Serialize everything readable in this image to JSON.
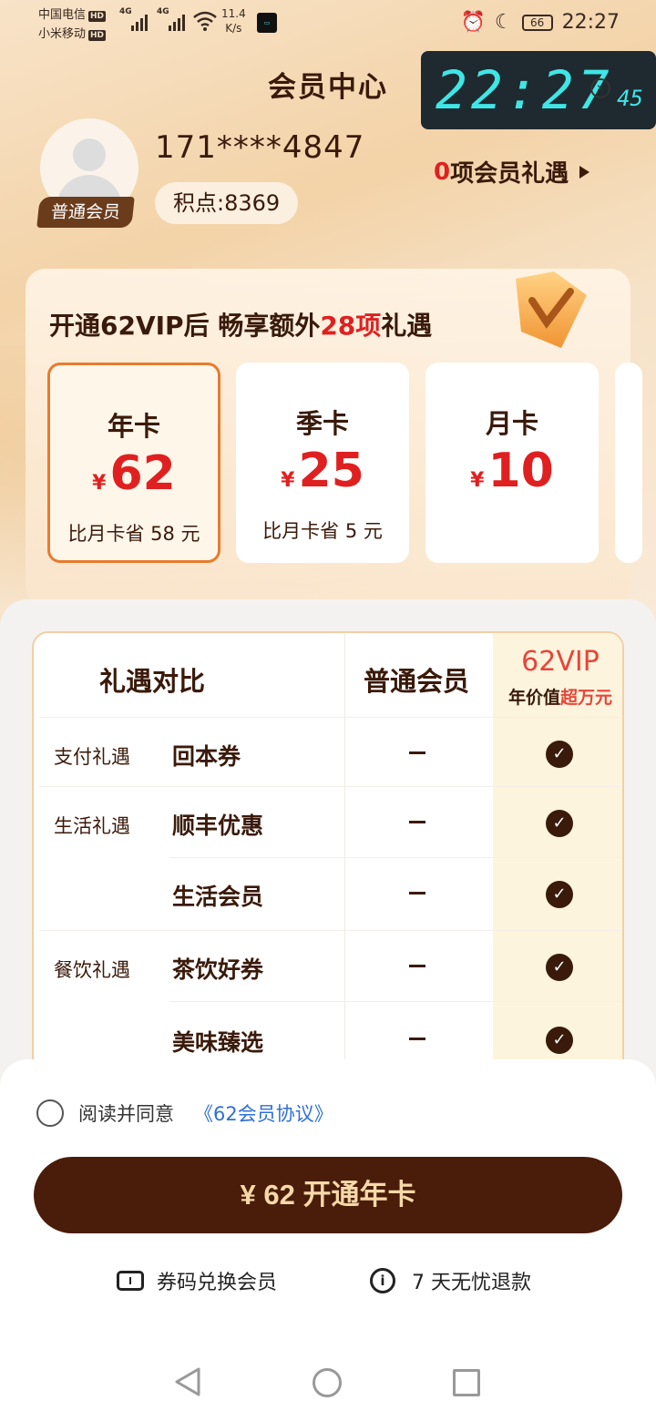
{
  "status": {
    "carrier1": "中国电信",
    "carrier2": "小米移动",
    "hd": "HD",
    "net": "4G",
    "speed_value": "11.4",
    "speed_unit": "K/s",
    "battery": "66",
    "time": "22:27"
  },
  "clock_widget": {
    "hm": "22:27",
    "sec": "45"
  },
  "header": {
    "title": "会员中心"
  },
  "user": {
    "phone": "171****4847",
    "level_badge": "普通会员",
    "points_label": "积点:8369",
    "benefit_count": "0",
    "benefit_label": "项会员礼遇"
  },
  "promo": {
    "prefix": "开通62VIP后 畅享额外",
    "highlight": "28项",
    "suffix": "礼遇"
  },
  "plans": [
    {
      "name": "年卡",
      "currency": "¥",
      "price": "62",
      "save_text": "比月卡省  58  元",
      "selected": true
    },
    {
      "name": "季卡",
      "currency": "¥",
      "price": "25",
      "save_text": "比月卡省  5  元",
      "selected": false
    },
    {
      "name": "月卡",
      "currency": "¥",
      "price": "10",
      "save_text": "",
      "selected": false
    }
  ],
  "compare": {
    "header_label": "礼遇对比",
    "header_normal": "普通会员",
    "header_vip": "62VIP",
    "header_vip_sub_prefix": "年价值",
    "header_vip_sub_highlight": "超万元",
    "rows": [
      {
        "category": "支付礼遇",
        "item": "回本券"
      },
      {
        "category": "生活礼遇",
        "item": "顺丰优惠"
      },
      {
        "category": "",
        "item": "生活会员"
      },
      {
        "category": "餐饮礼遇",
        "item": "茶饮好券"
      },
      {
        "category": "",
        "item": "美味臻选"
      }
    ]
  },
  "footer": {
    "agree_text": "阅读并同意",
    "agreement_link": "《62会员协议》",
    "pay_button": "¥ 62  开通年卡",
    "redeem": "券码兑换会员",
    "refund": "7  天无忧退款"
  },
  "colors": {
    "accent_red": "#e02020",
    "brand_brown": "#4a1c0a",
    "selected_border": "#e87a2e",
    "link_blue": "#2e6fd8"
  }
}
